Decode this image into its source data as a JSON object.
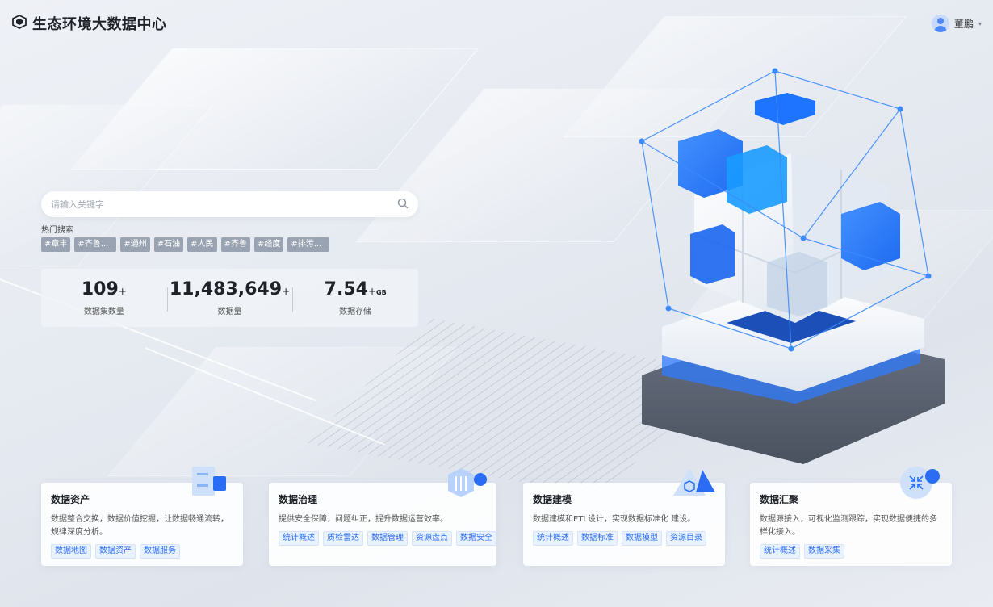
{
  "header": {
    "title": "生态环境大数据中心",
    "user_name": "董鹏"
  },
  "search": {
    "placeholder": "请输入关键字",
    "hot_title": "热门搜索",
    "hot_tags": [
      "#章丰",
      "#齐鲁...",
      "#通州",
      "#石油",
      "#人民",
      "#齐鲁",
      "#经度",
      "#排污..."
    ]
  },
  "stats": [
    {
      "value": "109",
      "suffix": "+",
      "unit": "",
      "label": "数据集数量"
    },
    {
      "value": "11,483,649",
      "suffix": "+",
      "unit": "",
      "label": "数据量"
    },
    {
      "value": "7.54",
      "suffix": "+",
      "unit": "GB",
      "label": "数据存储"
    }
  ],
  "cards": [
    {
      "title": "数据资产",
      "desc": "数据整合交换，数据价值挖掘，让数据畅通流转，规律深度分析。",
      "tags": [
        "数据地图",
        "数据资产",
        "数据服务"
      ]
    },
    {
      "title": "数据治理",
      "desc": "提供安全保障，问题纠正，提升数据运营效率。",
      "tags": [
        "统计概述",
        "质检雷达",
        "数据管理",
        "资源盘点",
        "数据安全"
      ]
    },
    {
      "title": "数据建模",
      "desc": "数据建模和ETL设计，实现数据标准化 建设。",
      "tags": [
        "统计概述",
        "数据标准",
        "数据模型",
        "资源目录"
      ]
    },
    {
      "title": "数据汇聚",
      "desc": "数据源接入，可视化监测跟踪，实现数据便捷的多样化接入。",
      "tags": [
        "统计概述",
        "数据采集"
      ]
    }
  ],
  "colors": {
    "accent": "#2a6df4",
    "tag_bg": "#9aa3b2"
  }
}
